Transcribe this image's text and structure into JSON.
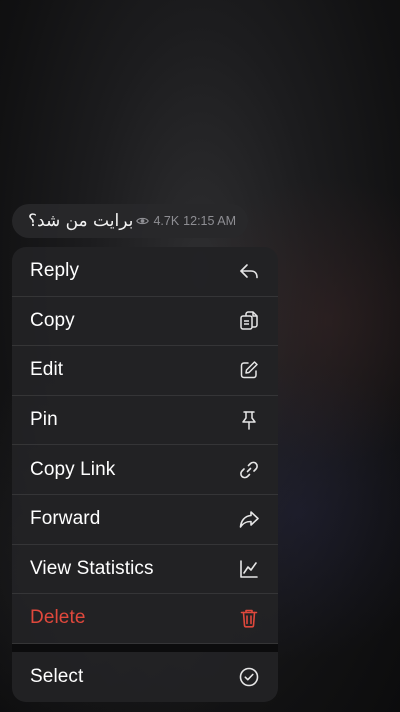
{
  "message": {
    "text": "برایت من شد؟",
    "views": "4.7K",
    "time": "12:15 AM"
  },
  "menu": {
    "items": [
      {
        "label": "Reply",
        "icon": "reply-icon"
      },
      {
        "label": "Copy",
        "icon": "copy-icon"
      },
      {
        "label": "Edit",
        "icon": "edit-icon"
      },
      {
        "label": "Pin",
        "icon": "pin-icon"
      },
      {
        "label": "Copy Link",
        "icon": "link-icon"
      },
      {
        "label": "Forward",
        "icon": "forward-icon"
      },
      {
        "label": "View Statistics",
        "icon": "statistics-icon"
      },
      {
        "label": "Delete",
        "icon": "trash-icon"
      }
    ],
    "select_label": "Select"
  },
  "colors": {
    "destructive": "#e0483c",
    "secondary_text": "#8e8e93"
  }
}
